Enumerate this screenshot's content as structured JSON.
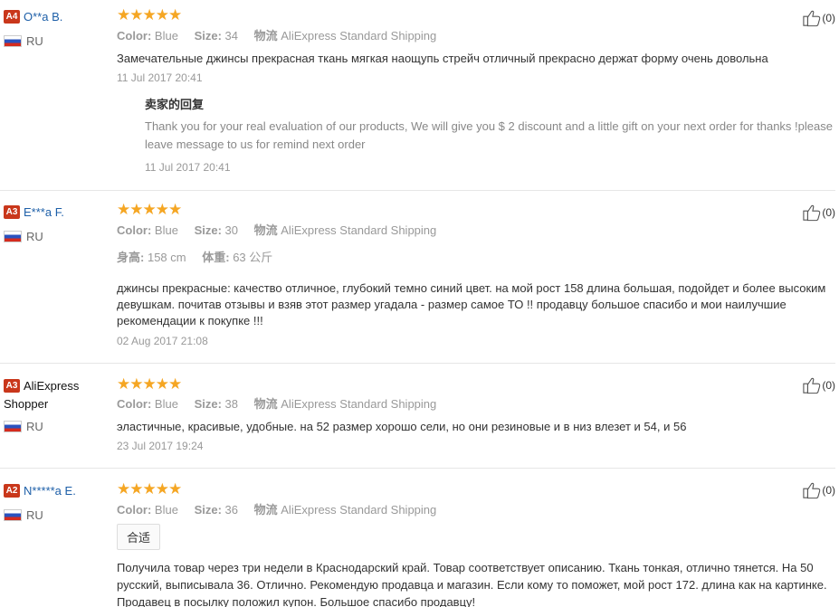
{
  "labels": {
    "color": "Color:",
    "size": "Size:",
    "shipping": "物流",
    "height": "身高:",
    "weight": "体重:",
    "reply_title": "卖家的回复"
  },
  "reviews": [
    {
      "level": "A4",
      "name": "O**a B.",
      "country": "RU",
      "stars": "★★★★★",
      "color": "Blue",
      "size": "34",
      "shipping": "AliExpress Standard Shipping",
      "text": "Замечательные джинсы прекрасная ткань мягкая наощупь стрейч отличный прекрасно держат форму очень довольна",
      "date": "11 Jul 2017 20:41",
      "reply_text": "Thank you for your real evaluation of our products, We will give you $ 2 discount and a little gift on your next order for thanks !please leave message to us for remind next order",
      "reply_date": "11 Jul 2017 20:41",
      "helpful": "(0)"
    },
    {
      "level": "A3",
      "name": "E***a F.",
      "country": "RU",
      "stars": "★★★★★",
      "color": "Blue",
      "size": "30",
      "shipping": "AliExpress Standard Shipping",
      "height": "158 cm",
      "weight": "63 公斤",
      "text": "джинсы прекрасные: качество отличное, глубокий темно синий цвет. на мой рост 158 длина большая, подойдет и более высоким девушкам. почитав отзывы и взяв этот размер угадала - размер самое ТО !! продавцу большое спасибо и мои наилучшие рекомендации к покупке !!!",
      "date": "02 Aug 2017 21:08",
      "helpful": "(0)"
    },
    {
      "level": "A3",
      "name": "AliExpress Shopper",
      "country": "RU",
      "stars": "★★★★★",
      "color": "Blue",
      "size": "38",
      "shipping": "AliExpress Standard Shipping",
      "text": "эластичные, красивые, удобные. на 52 размер хорошо сели, но они резиновые и в низ влезет и 54, и 56",
      "date": "23 Jul 2017 19:24",
      "helpful": "(0)"
    },
    {
      "level": "A2",
      "name": "N*****a E.",
      "country": "RU",
      "stars": "★★★★★",
      "color": "Blue",
      "size": "36",
      "shipping": "AliExpress Standard Shipping",
      "tag": "合适",
      "text": "Получила товар через три недели в Краснодарский край. Товар соответствует описанию. Ткань тонкая, отлично тянется. На 50 русский, выписывала 36. Отлично. Рекомендую продавца и магазин. Если кому то поможет, мой рост 172. длина как на картинке. Продавец в посылку положил купон. Большое спасибо продавцу!",
      "helpful": "(0)"
    }
  ]
}
